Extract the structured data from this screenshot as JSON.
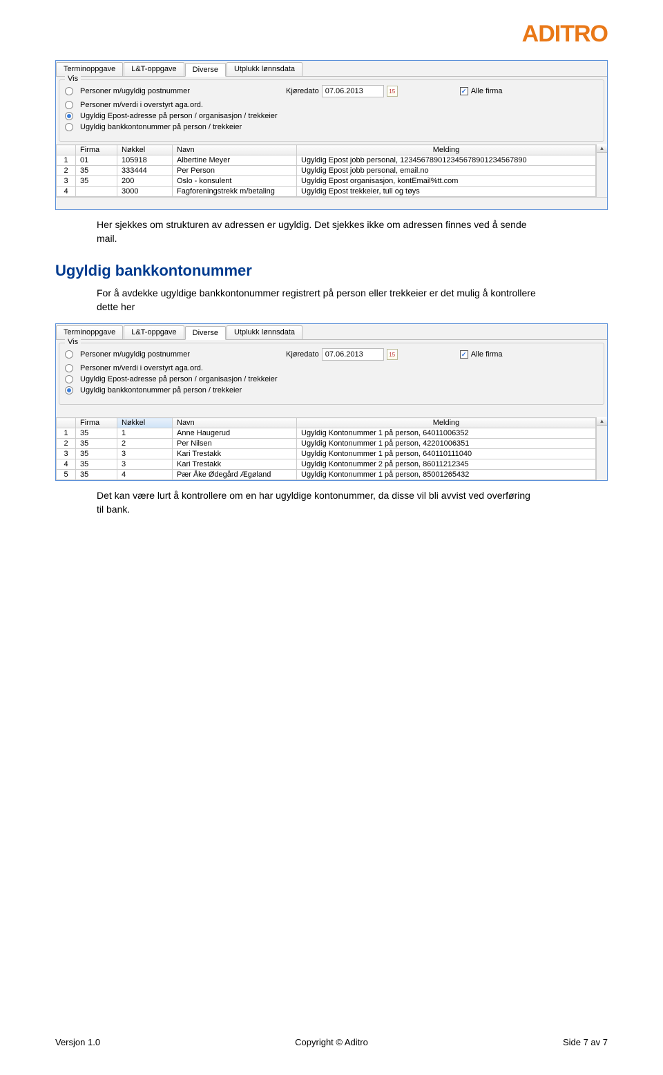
{
  "logo": "ADITRO",
  "screenshot1": {
    "tabs": [
      "Terminoppgave",
      "L&T-oppgave",
      "Diverse",
      "Utplukk lønnsdata"
    ],
    "active_tab": "Diverse",
    "legend": "Vis",
    "radios": [
      "Personer m/ugyldig postnummer",
      "Personer m/verdi i overstyrt aga.ord.",
      "Ugyldig Epost-adresse på person / organisasjon / trekkeier",
      "Ugyldig bankkontonummer på person / trekkeier"
    ],
    "selected_radio_index": 2,
    "date_label": "Kjøredato",
    "date_value": "07.06.2013",
    "checkbox_label": "Alle firma",
    "checkbox_checked": true,
    "columns": [
      "",
      "Firma",
      "Nøkkel",
      "Navn",
      "Melding"
    ],
    "rows": [
      {
        "n": "1",
        "firma": "01",
        "nokkel": "105918",
        "navn": "Albertine Meyer",
        "melding": "Ugyldig Epost jobb personal, 123456789012345678901234567890"
      },
      {
        "n": "2",
        "firma": "35",
        "nokkel": "333444",
        "navn": "Per Person",
        "melding": "Ugyldig Epost jobb personal, email.no"
      },
      {
        "n": "3",
        "firma": "35",
        "nokkel": "200",
        "navn": "Oslo - konsulent",
        "melding": "Ugyldig Epost organisasjon, kontEmail%tt.com"
      },
      {
        "n": "4",
        "firma": "",
        "nokkel": "3000",
        "navn": "Fagforeningstrekk m/betaling",
        "melding": "Ugyldig Epost trekkeier, tull og tøys"
      }
    ]
  },
  "para1": "Her sjekkes om strukturen av adressen er ugyldig. Det sjekkes ikke om adressen finnes ved å sende mail.",
  "heading": "Ugyldig bankkontonummer",
  "para2": "For å avdekke ugyldige bankkontonummer registrert på person eller trekkeier er det mulig å kontrollere dette her",
  "screenshot2": {
    "tabs": [
      "Terminoppgave",
      "L&T-oppgave",
      "Diverse",
      "Utplukk lønnsdata"
    ],
    "active_tab": "Diverse",
    "legend": "Vis",
    "radios": [
      "Personer m/ugyldig postnummer",
      "Personer m/verdi i overstyrt aga.ord.",
      "Ugyldig Epost-adresse på person / organisasjon / trekkeier",
      "Ugyldig bankkontonummer på person / trekkeier"
    ],
    "selected_radio_index": 3,
    "date_label": "Kjøredato",
    "date_value": "07.06.2013",
    "checkbox_label": "Alle firma",
    "checkbox_checked": true,
    "columns": [
      "",
      "Firma",
      "Nøkkel",
      "Navn",
      "Melding"
    ],
    "rows": [
      {
        "n": "1",
        "firma": "35",
        "nokkel": "1",
        "navn": "Anne Haugerud",
        "melding": "Ugyldig Kontonummer 1 på person, 64011006352"
      },
      {
        "n": "2",
        "firma": "35",
        "nokkel": "2",
        "navn": "Per Nilsen",
        "melding": "Ugyldig Kontonummer 1 på person, 42201006351"
      },
      {
        "n": "3",
        "firma": "35",
        "nokkel": "3",
        "navn": "Kari Trestakk",
        "melding": "Ugyldig Kontonummer 1 på person, 640110111040"
      },
      {
        "n": "4",
        "firma": "35",
        "nokkel": "3",
        "navn": "Kari Trestakk",
        "melding": "Ugyldig Kontonummer 2 på person, 86011212345"
      },
      {
        "n": "5",
        "firma": "35",
        "nokkel": "4",
        "navn": "Pær Åke Ødegård Ægøland",
        "melding": "Ugyldig Kontonummer 1 på person, 85001265432"
      }
    ]
  },
  "para3": "Det kan være lurt å kontrollere om en har ugyldige kontonummer, da disse vil bli avvist ved overføring til bank.",
  "footer": {
    "left": "Versjon 1.0",
    "center": "Copyright © Aditro",
    "right": "Side 7 av 7"
  }
}
